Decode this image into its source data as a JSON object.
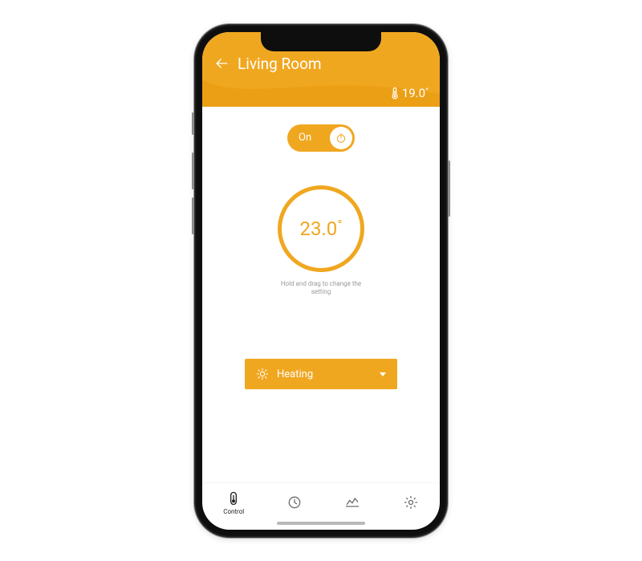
{
  "header": {
    "title": "Living Room",
    "current_temp": "19.0"
  },
  "toggle": {
    "label": "On"
  },
  "dial": {
    "value": "23.0",
    "hint": "Hold and drag to change the setting"
  },
  "mode": {
    "label": "Heating"
  },
  "nav": {
    "control": "Control"
  },
  "colors": {
    "accent": "#f0a720"
  }
}
